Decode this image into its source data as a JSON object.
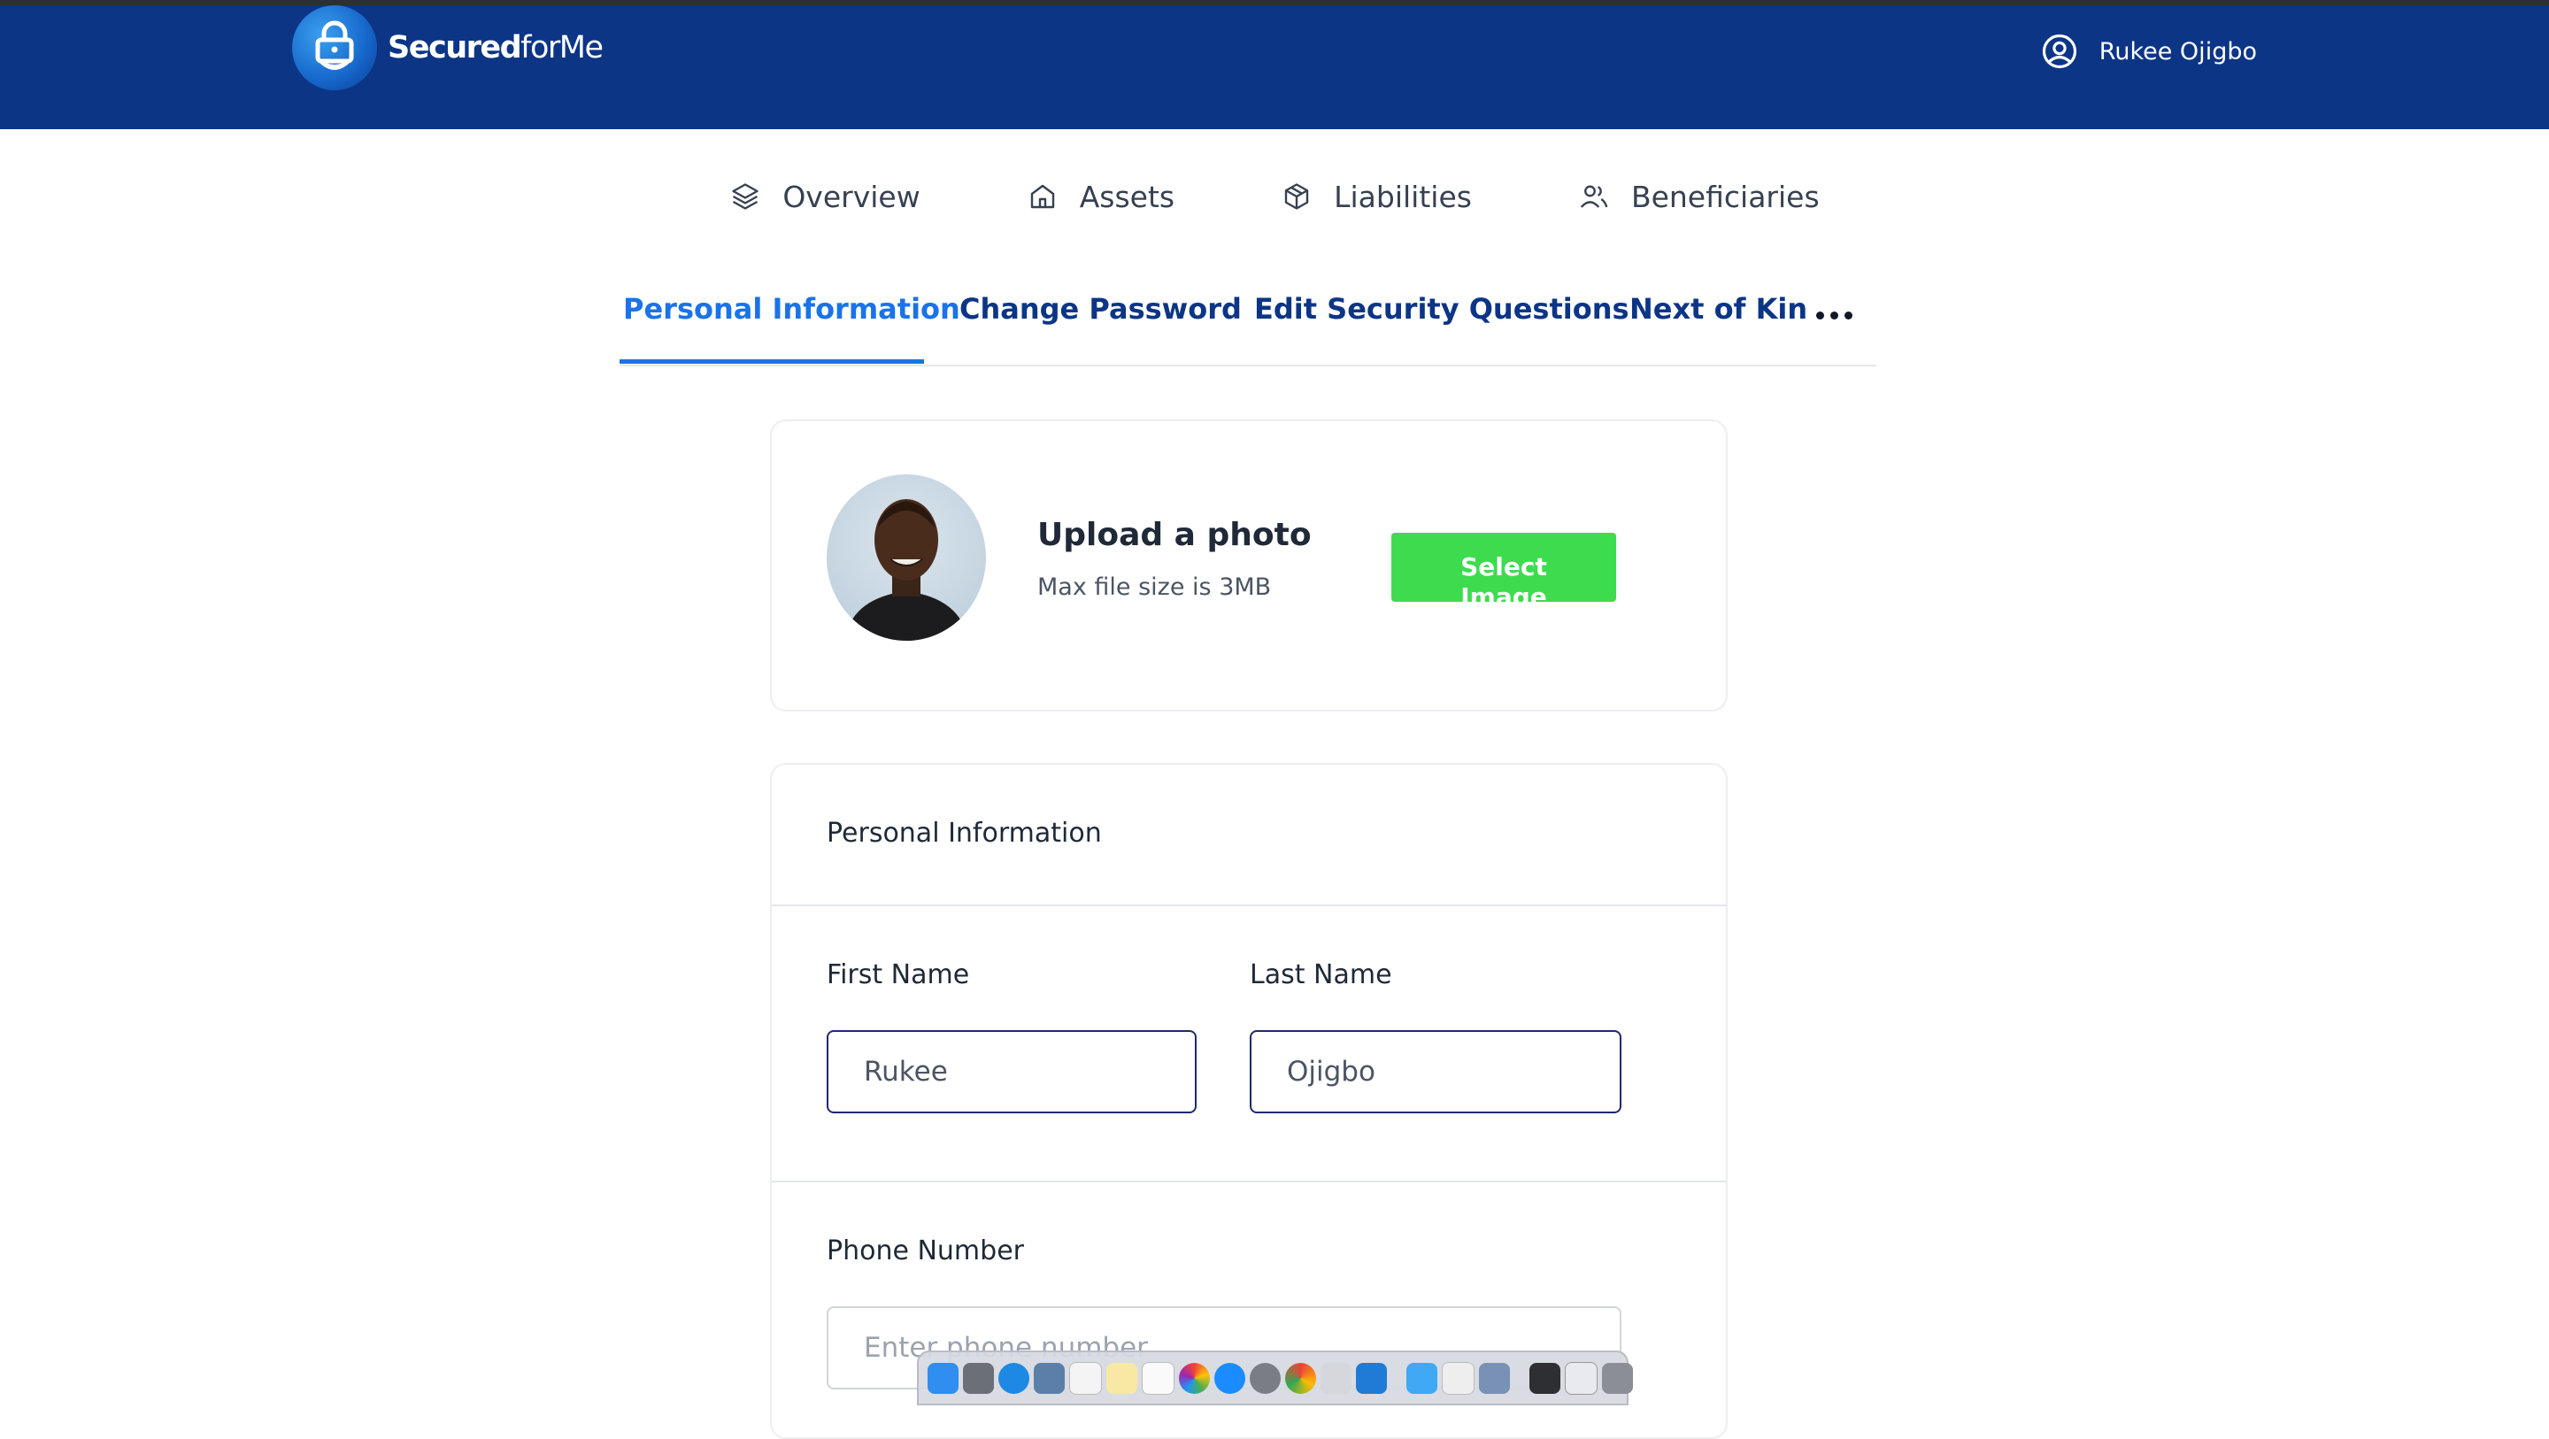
{
  "brand": {
    "name_bold": "Secured",
    "name_light": "forMe",
    "colors": {
      "header": "#0c3586",
      "accent": "#1a73e8",
      "button": "#3ddc4f"
    }
  },
  "user": {
    "name": "Rukee Ojigbo",
    "icon": "user-circle-icon"
  },
  "main_nav": [
    {
      "label": "Overview",
      "icon": "layers-icon"
    },
    {
      "label": "Assets",
      "icon": "home-icon"
    },
    {
      "label": "Liabilities",
      "icon": "package-icon"
    },
    {
      "label": "Beneficiaries",
      "icon": "users-icon"
    }
  ],
  "tabs": [
    {
      "label": "Personal Information",
      "active": true
    },
    {
      "label": "Change Password",
      "active": false
    },
    {
      "label": "Edit Security Questions",
      "active": false
    },
    {
      "label": "Next of Kin",
      "active": false
    }
  ],
  "upload": {
    "title": "Upload a photo",
    "subtitle": "Max file size is 3MB",
    "button_label": "Select Image"
  },
  "personal_info": {
    "section_title": "Personal Information",
    "first_name": {
      "label": "First Name",
      "value": "Rukee"
    },
    "last_name": {
      "label": "Last Name",
      "value": "Ojigbo"
    },
    "phone": {
      "label": "Phone Number",
      "placeholder": "Enter phone number",
      "value": ""
    }
  }
}
